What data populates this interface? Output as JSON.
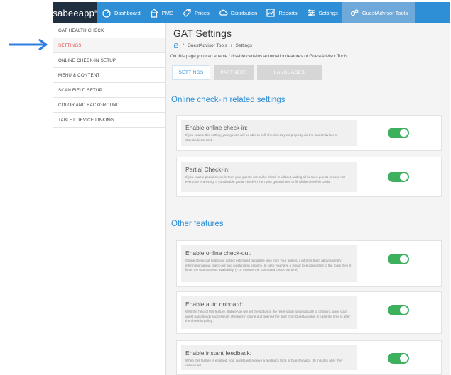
{
  "nav": {
    "brand": "sabeeapp",
    "brand_tm": "®",
    "items": [
      {
        "label": "Dashboard",
        "icon": "dashboard-icon"
      },
      {
        "label": "PMS",
        "icon": "pms-icon"
      },
      {
        "label": "Prices",
        "icon": "prices-icon"
      },
      {
        "label": "Distribution",
        "icon": "distribution-icon"
      },
      {
        "label": "Reports",
        "icon": "reports-icon"
      },
      {
        "label": "Settings",
        "icon": "settings-icon"
      },
      {
        "label": "GuestAdvisor Tools",
        "icon": "guestadvisor-icon"
      }
    ],
    "active": "GuestAdvisor Tools"
  },
  "sidebar": {
    "items": [
      {
        "label": "GAT HEALTH CHECK"
      },
      {
        "label": "SETTINGS"
      },
      {
        "label": "ONLINE CHECK-IN SETUP"
      },
      {
        "label": "MENU & CONTENT"
      },
      {
        "label": "SCAN FIELD SETUP"
      },
      {
        "label": "COLOR AND BACKGROUND"
      },
      {
        "label": "TABLET DEVICE LINKING"
      }
    ],
    "active": "SETTINGS"
  },
  "main": {
    "title": "GAT Settings",
    "breadcrumb": [
      "GuestAdvisor Tools",
      "Settings"
    ],
    "breadcrumb_sep": "/",
    "intro": "On this page you can enable / disable certains automation features of GuestAdvisor Tools.",
    "tabs": [
      {
        "label": "SETTINGS"
      },
      {
        "label": "PARTNERS"
      },
      {
        "label": "LANGUAGES"
      }
    ],
    "active_tab": "SETTINGS",
    "sections": [
      {
        "title": "Online check-in related settings",
        "settings": [
          {
            "title": "Enable online check-in:",
            "description": "If you enable this setting, your guests will be able to self-check-in to your property via the GuestAdvisor or GuestAdvisor Web.",
            "enabled": true
          },
          {
            "title": "Partial Check-in:",
            "description": "If you enable partial check-in then your guests can make check-in without adding all booked guests in case not everyone is arriving. If you disable partial check-in then your guests have to fill all the check-in cards.",
            "enabled": true
          }
        ]
      },
      {
        "title": "Other features",
        "settings": [
          {
            "title": "Enable online check-out:",
            "description": "Online check-out helps you collect estimated departure time from your guests, it informs them about usefully information about check-out and outstanding balance. In case you have a Smart lock connected to the room then it limits the room access availability. (+15 minutes the Estimated check-out time)",
            "enabled": true
          },
          {
            "title": "Enable auto onboard:",
            "description": "With the help of this feature, SabeeApp will set the status of the reservation automatically to onboard, once your guest has already successfully checked-in online and opened the door from GuestAdvisor, in case the time is after the check-in policy.",
            "enabled": true
          },
          {
            "title": "Enable instant feedback:",
            "description": "When this feature is enabled, your guests will receive a feedback form in GuestAdvisor, 30 minutes after they onboarded.",
            "enabled": true
          }
        ]
      }
    ]
  },
  "colors": {
    "nav_blue": "#2f8fd6",
    "brand_dark": "#1f2f3f",
    "active_red": "#e05050",
    "toggle_green": "#3db05e",
    "section_blue": "#2f8fd6"
  }
}
